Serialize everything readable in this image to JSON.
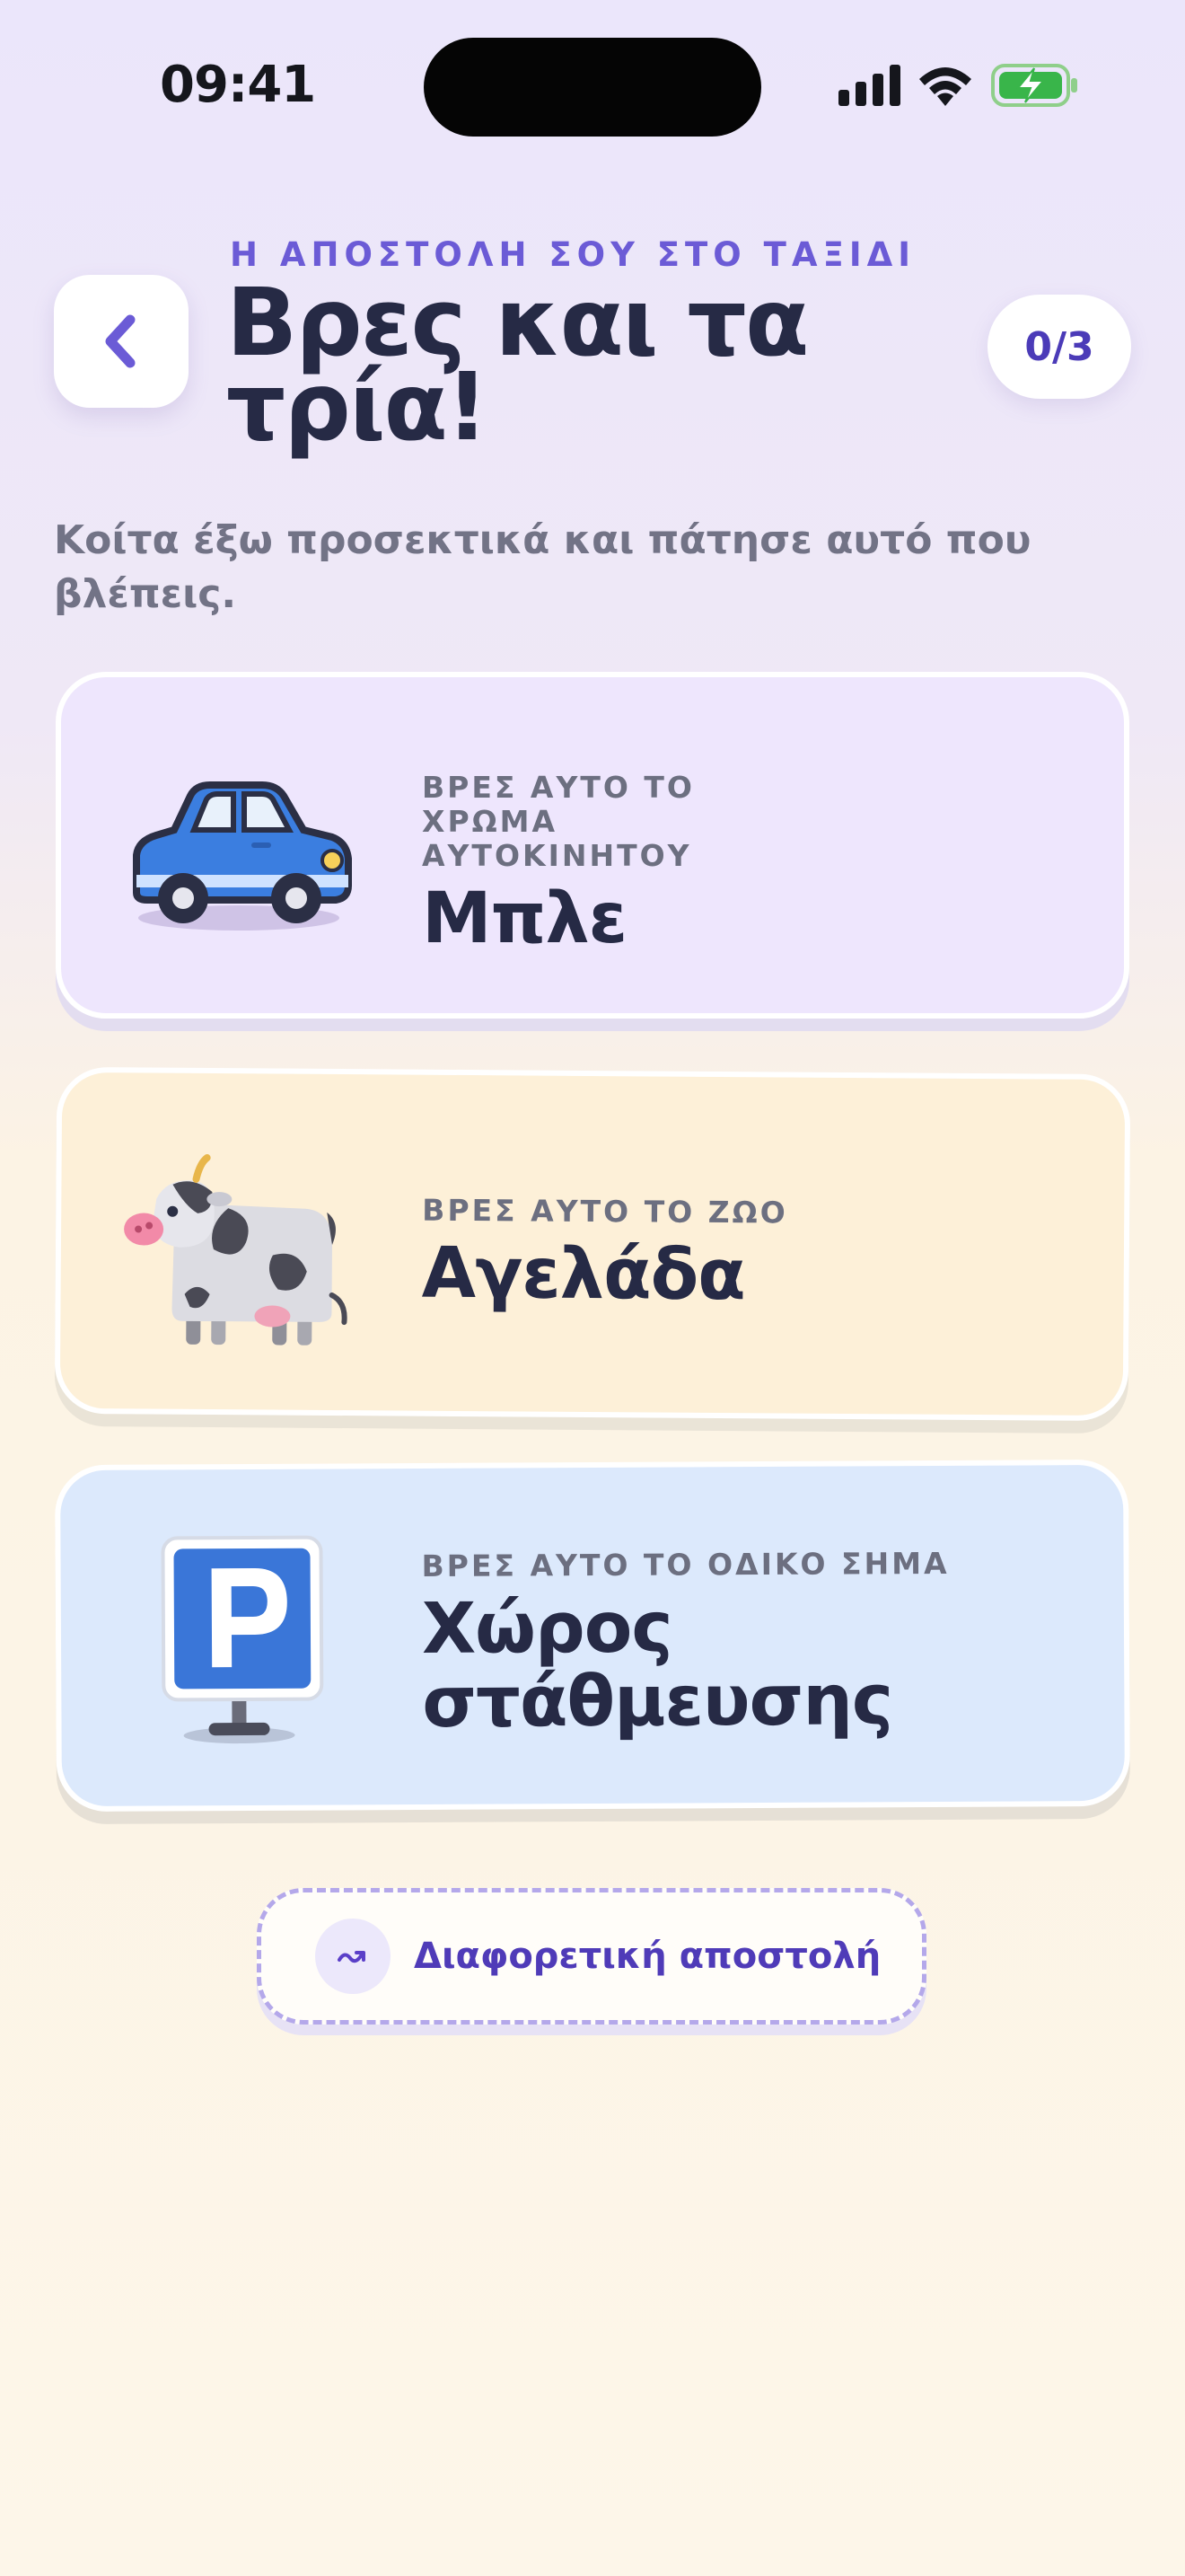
{
  "status_bar": {
    "time": "09:41",
    "icons": [
      "signal-icon",
      "wifi-icon",
      "battery-charging-icon"
    ]
  },
  "header": {
    "eyebrow": "Η ΑΠΟΣΤΟΛΗ ΣΟΥ ΣΤΟ ΤΑΞΙΔΙ",
    "title": "Βρες και τα τρία!",
    "counter": "0/3",
    "back_icon": "chevron-left-icon"
  },
  "subtitle": "Κοίτα έξω προσεκτικά και πάτησε αυτό που βλέπεις.",
  "cards": [
    {
      "label": "ΒΡΕΣ ΑΥΤΟ ΤΟ ΧΡΩΜΑ ΑΥΤΟΚΙΝΗΤΟΥ",
      "value": "Μπλε",
      "icon": "blue-car-icon",
      "bg": "#eee6fd"
    },
    {
      "label": "ΒΡΕΣ ΑΥΤΟ ΤΟ ΖΩΟ",
      "value": "Αγελάδα",
      "icon": "cow-icon",
      "bg": "#fdf0d8"
    },
    {
      "label": "ΒΡΕΣ ΑΥΤΟ ΤΟ ΟΔΙΚΟ ΣΗΜΑ",
      "value": "Χώρος στάθμευσης",
      "icon": "parking-sign-icon",
      "bg": "#dce9fc"
    }
  ],
  "alt_button": {
    "label": "Διαφορετική αποστολή",
    "icon": "shuffle-icon"
  },
  "colors": {
    "accent": "#6b5bd6",
    "title": "#262a45",
    "muted": "#727386"
  }
}
